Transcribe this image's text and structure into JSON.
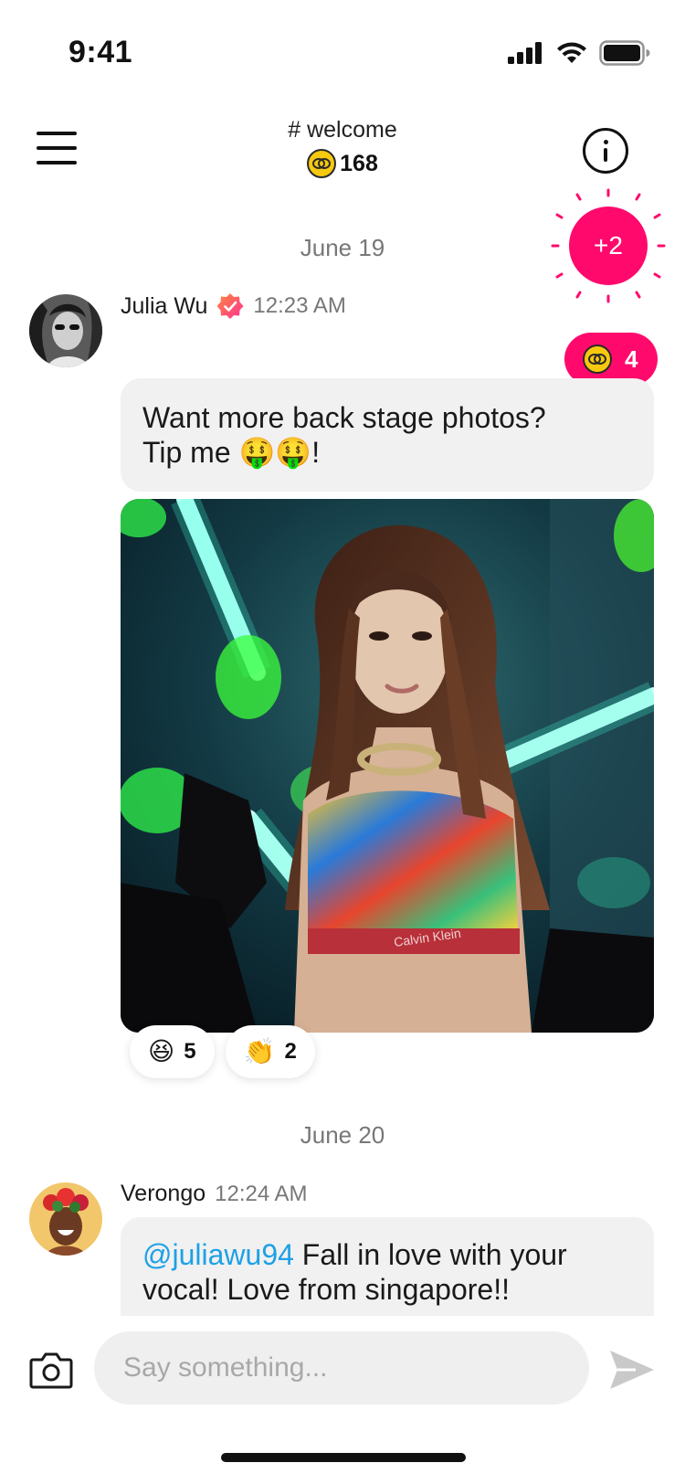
{
  "status_bar": {
    "time": "9:41"
  },
  "header": {
    "channel": "# welcome",
    "coin_balance": "168"
  },
  "burst_button": {
    "label": "+2"
  },
  "dates": [
    "June 19",
    "June 20"
  ],
  "messages": [
    {
      "sender": "Julia Wu",
      "verified": true,
      "time": "12:23 AM",
      "tip_count": "4",
      "text_line1": "Want more back stage photos?",
      "text_line2": "Tip me 🤑🤑!",
      "reactions": [
        {
          "emoji": "😆",
          "count": "5"
        },
        {
          "emoji": "👏",
          "count": "2"
        }
      ]
    },
    {
      "sender": "Verongo",
      "time": "12:24 AM",
      "mention": "@juliawu94",
      "text_line1_rest": " Fall in love with your",
      "text_line2": "vocal! Love from singapore!!"
    }
  ],
  "composer": {
    "placeholder": "Say something..."
  },
  "colors": {
    "accent": "#ff0a6c",
    "coin": "#f6c90e",
    "mention": "#1da1e6",
    "bubble": "#f1f1f1"
  }
}
